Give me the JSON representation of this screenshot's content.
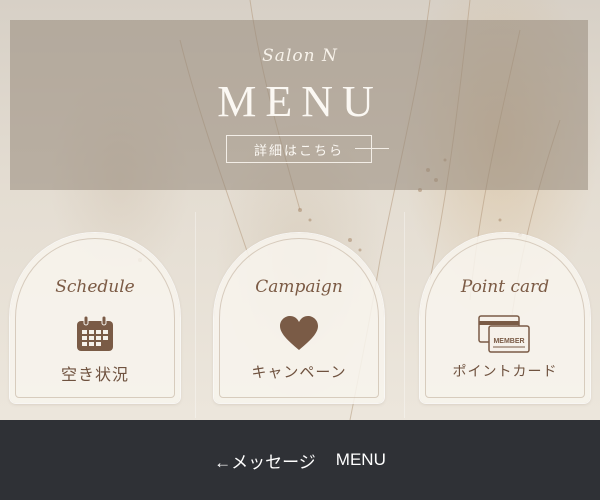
{
  "header": {
    "brand": "Salon N",
    "title": "MENU",
    "details_button": "詳細はこちら"
  },
  "cards": [
    {
      "script": "Schedule",
      "icon": "calendar-icon",
      "label": "空き状況"
    },
    {
      "script": "Campaign",
      "icon": "heart-icon",
      "label": "キャンペーン"
    },
    {
      "script": "Point card",
      "icon": "member-card-icon",
      "label": "ポイントカード",
      "icon_text": "MEMBER"
    }
  ],
  "footer": {
    "back_label": "←メッセージ",
    "menu_label": "MENU"
  },
  "colors": {
    "accent_brown": "#7b5a44",
    "footer_bg": "#2f3136",
    "header_band": "#96887a"
  }
}
